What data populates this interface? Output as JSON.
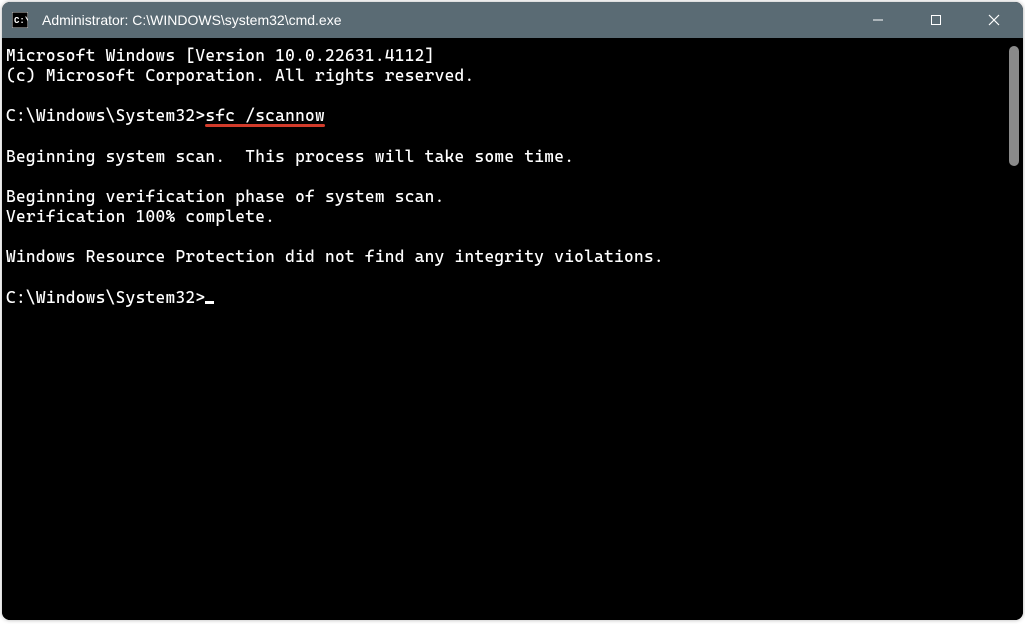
{
  "titlebar": {
    "title": "Administrator: C:\\WINDOWS\\system32\\cmd.exe"
  },
  "terminal": {
    "line1": "Microsoft Windows [Version 10.0.22631.4112]",
    "line2": "(c) Microsoft Corporation. All rights reserved.",
    "blank1": "",
    "prompt1": "C:\\Windows\\System32>",
    "command1": "sfc /scannow",
    "blank2": "",
    "line3": "Beginning system scan.  This process will take some time.",
    "blank3": "",
    "line4": "Beginning verification phase of system scan.",
    "line5": "Verification 100% complete.",
    "blank4": "",
    "line6": "Windows Resource Protection did not find any integrity violations.",
    "blank5": "",
    "prompt2": "C:\\Windows\\System32>"
  }
}
